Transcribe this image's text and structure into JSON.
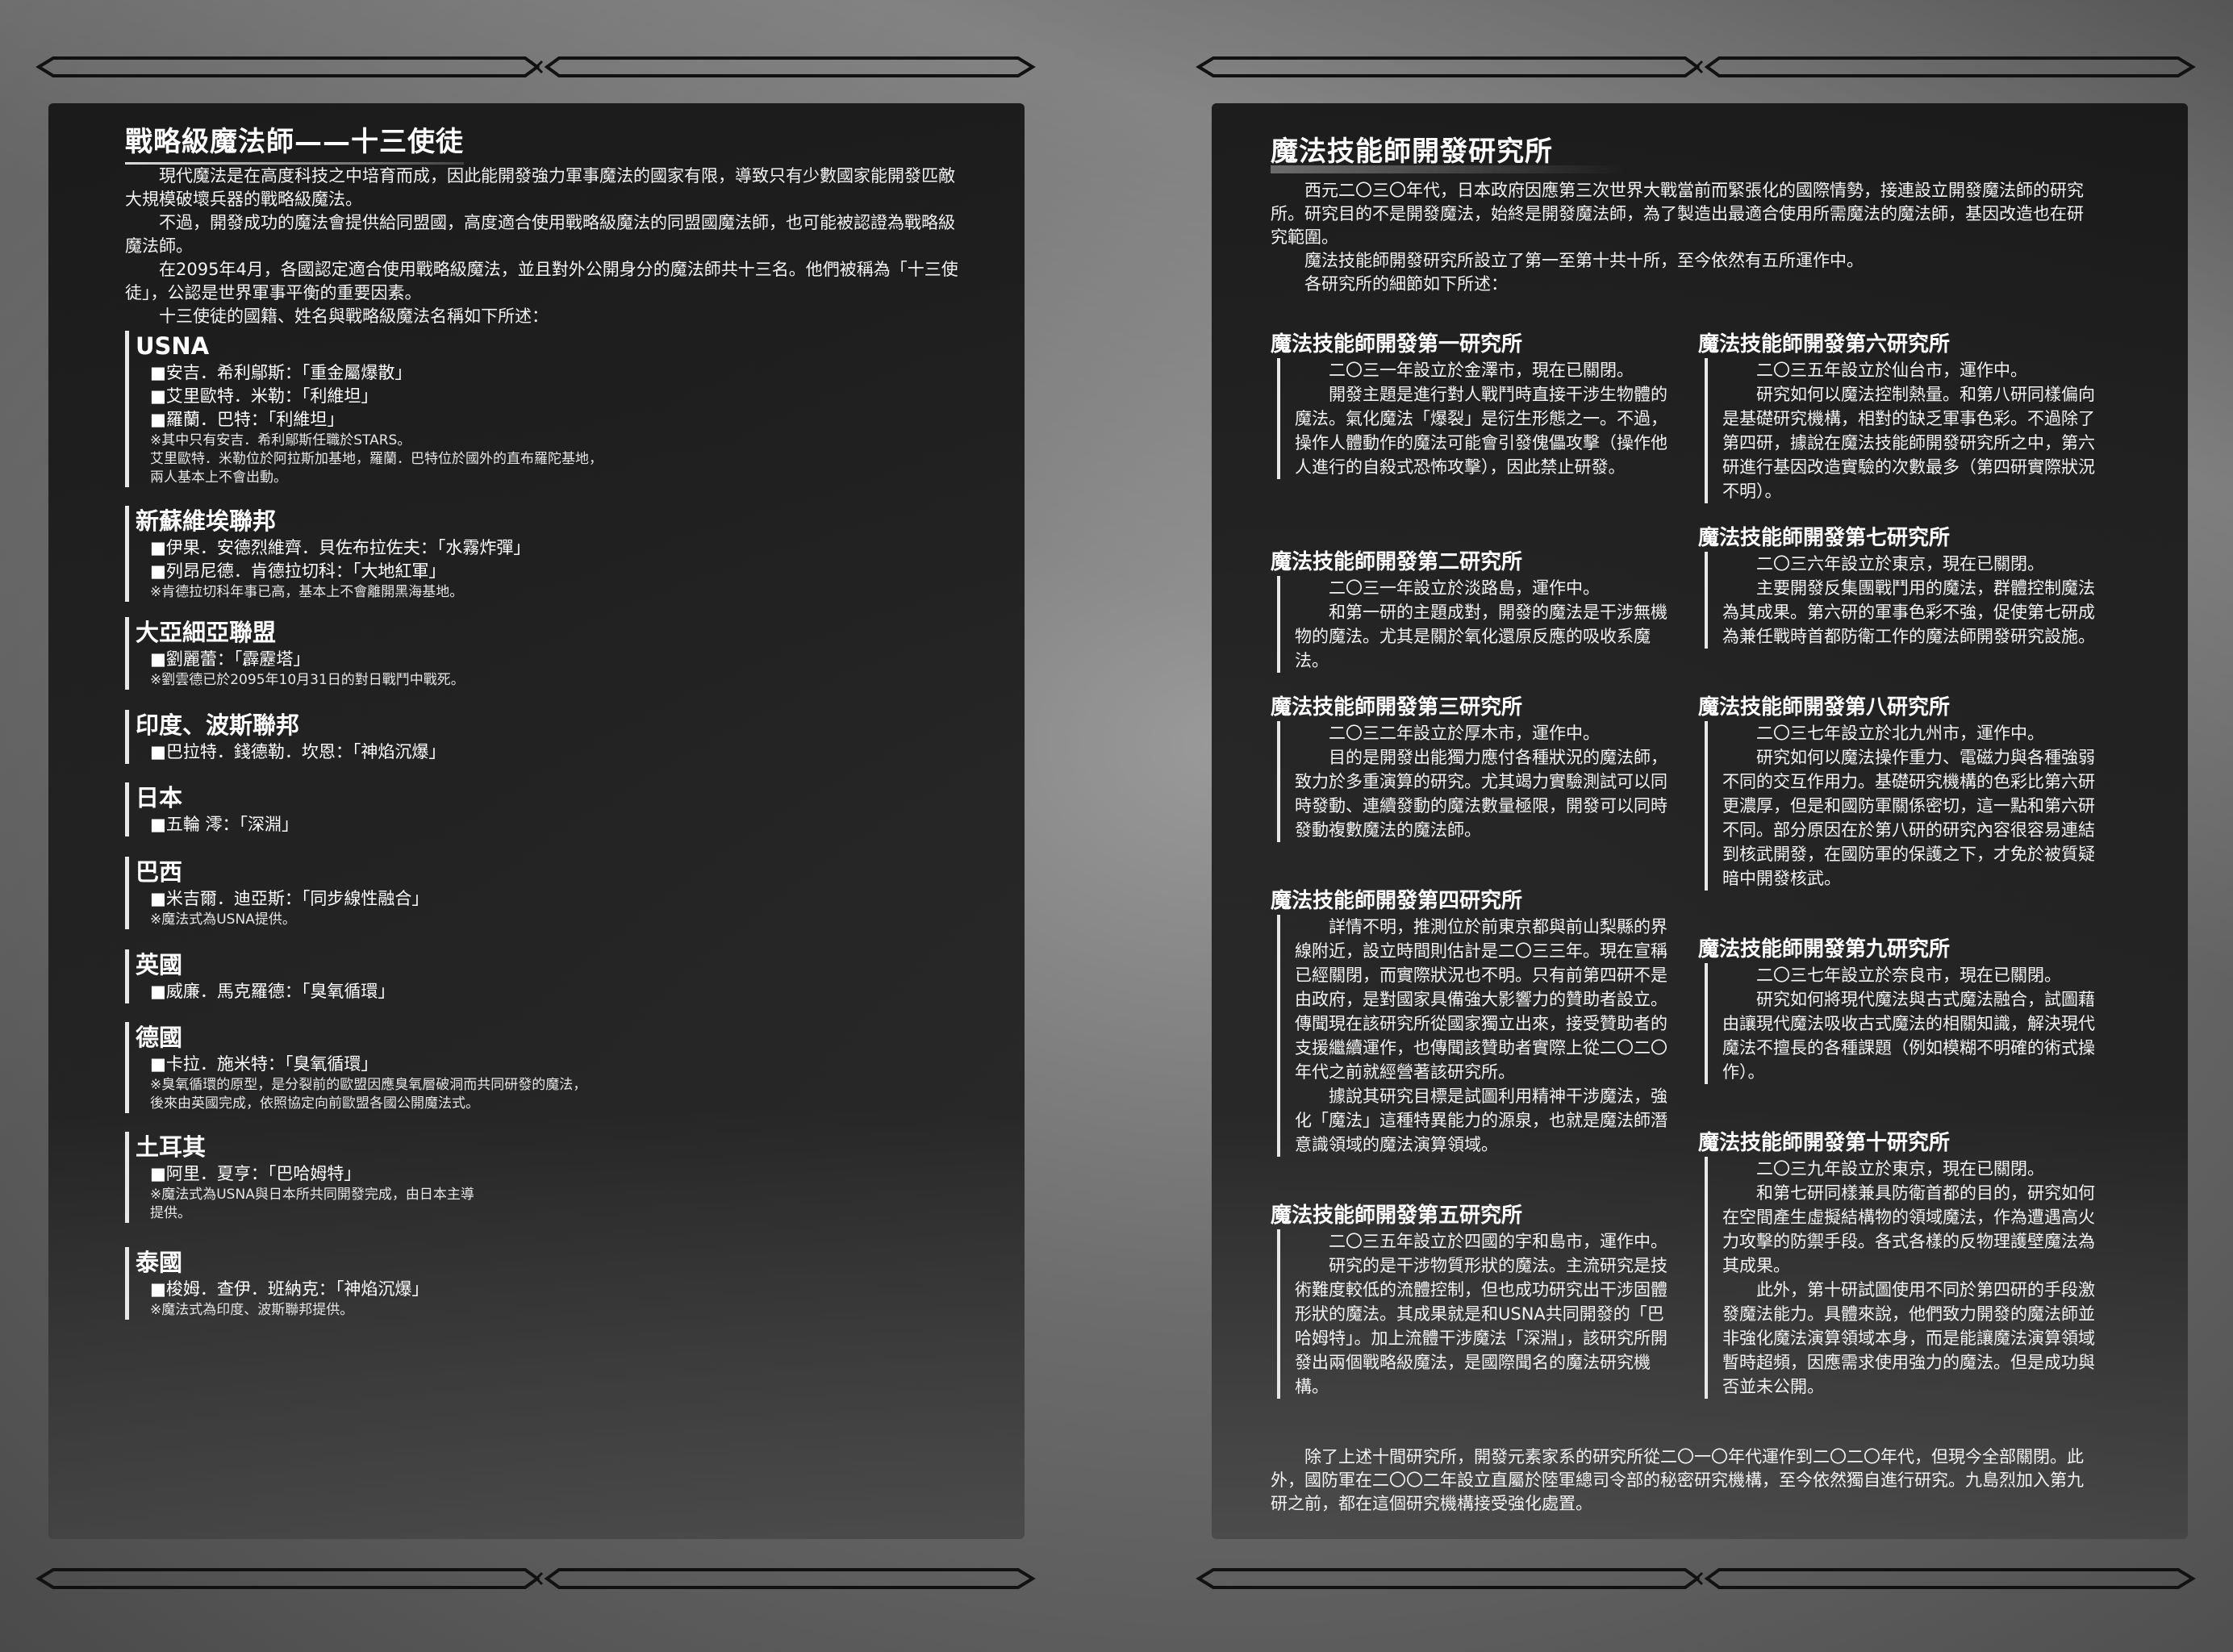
{
  "left_page": {
    "title": "戰略級魔法師——十三使徒",
    "intro": [
      "現代魔法是在高度科技之中培育而成，因此能開發強力軍事魔法的國家有限，導致只有少數國家能開發匹敵大規模破壞兵器的戰略級魔法。",
      "不過，開發成功的魔法會提供給同盟國，高度適合使用戰略級魔法的同盟國魔法師，也可能被認證為戰略級魔法師。",
      "在2095年4月，各國認定適合使用戰略級魔法，並且對外公開身分的魔法師共十三名。他們被稱為「十三使徒」，公認是世界軍事平衡的重要因素。",
      "十三使徒的國籍、姓名與戰略級魔法名稱如下所述："
    ],
    "nations": [
      {
        "name": "USNA",
        "members": [
          "■安吉．希利鄔斯：「重金屬爆散」",
          "■艾里歐特．米勒：「利維坦」",
          "■羅蘭．巴特：「利維坦」"
        ],
        "notes": [
          "※其中只有安吉．希利鄔斯任職於STARS。",
          "艾里歐特．米勒位於阿拉斯加基地，羅蘭．巴特位於國外的直布羅陀基地，",
          "兩人基本上不會出動。"
        ]
      },
      {
        "name": "新蘇維埃聯邦",
        "members": [
          "■伊果．安德烈維齊．貝佐布拉佐夫：「水霧炸彈」",
          "■列昂尼德．肯德拉切科：「大地紅軍」"
        ],
        "notes": [
          "※肯德拉切科年事已高，基本上不會離開黑海基地。"
        ]
      },
      {
        "name": "大亞細亞聯盟",
        "members": [
          "■劉麗蕾：「霹靂塔」"
        ],
        "notes": [
          "※劉雲德已於2095年10月31日的對日戰鬥中戰死。"
        ]
      },
      {
        "name": "印度、波斯聯邦",
        "members": [
          "■巴拉特．錢德勒．坎恩：「神焰沉爆」"
        ],
        "notes": []
      },
      {
        "name": "日本",
        "members": [
          "■五輪 澪：「深淵」"
        ],
        "notes": []
      },
      {
        "name": "巴西",
        "members": [
          "■米吉爾．迪亞斯：「同步線性融合」"
        ],
        "notes": [
          "※魔法式為USNA提供。"
        ]
      },
      {
        "name": "英國",
        "members": [
          "■威廉．馬克羅德：「臭氧循環」"
        ],
        "notes": []
      },
      {
        "name": "德國",
        "members": [
          "■卡拉．施米特：「臭氧循環」"
        ],
        "notes": [
          "※臭氧循環的原型，是分裂前的歐盟因應臭氧層破洞而共同研發的魔法，",
          "後來由英國完成，依照協定向前歐盟各國公開魔法式。"
        ]
      },
      {
        "name": "土耳其",
        "members": [
          "■阿里．夏亨：「巴哈姆特」"
        ],
        "notes": [
          "※魔法式為USNA與日本所共同開發完成，由日本主導",
          "提供。"
        ]
      },
      {
        "name": "泰國",
        "members": [
          "■梭姆．查伊．班納克：「神焰沉爆」"
        ],
        "notes": [
          "※魔法式為印度、波斯聯邦提供。"
        ]
      }
    ]
  },
  "right_page": {
    "title": "魔法技能師開發研究所",
    "intro": [
      "西元二〇三〇年代，日本政府因應第三次世界大戰當前而緊張化的國際情勢，接連設立開發魔法師的研究所。研究目的不是開發魔法，始終是開發魔法師，為了製造出最適合使用所需魔法的魔法師，基因改造也在研究範圍。",
      "魔法技能師開發研究所設立了第一至第十共十所，至今依然有五所運作中。",
      "各研究所的細節如下所述："
    ],
    "institutes": [
      {
        "heading": "魔法技能師開發第一研究所",
        "paragraphs": [
          "二〇三一年設立於金澤市，現在已關閉。",
          "開發主題是進行對人戰鬥時直接干涉生物體的魔法。氣化魔法「爆裂」是衍生形態之一。不過，操作人體動作的魔法可能會引發傀儡攻擊（操作他人進行的自殺式恐怖攻擊），因此禁止研發。"
        ]
      },
      {
        "heading": "魔法技能師開發第二研究所",
        "paragraphs": [
          "二〇三一年設立於淡路島，運作中。",
          "和第一研的主題成對，開發的魔法是干涉無機物的魔法。尤其是關於氧化還原反應的吸收系魔法。"
        ]
      },
      {
        "heading": "魔法技能師開發第三研究所",
        "paragraphs": [
          "二〇三二年設立於厚木市，運作中。",
          "目的是開發出能獨力應付各種狀況的魔法師，致力於多重演算的研究。尤其竭力實驗測試可以同時發動、連續發動的魔法數量極限，開發可以同時發動複數魔法的魔法師。"
        ]
      },
      {
        "heading": "魔法技能師開發第四研究所",
        "paragraphs": [
          "詳情不明，推測位於前東京都與前山梨縣的界線附近，設立時間則估計是二〇三三年。現在宣稱已經關閉，而實際狀況也不明。只有前第四研不是由政府，是對國家具備強大影響力的贊助者設立。傳聞現在該研究所從國家獨立出來，接受贊助者的支援繼續運作，也傳聞該贊助者實際上從二〇二〇年代之前就經營著該研究所。",
          "據說其研究目標是試圖利用精神干涉魔法，強化「魔法」這種特異能力的源泉，也就是魔法師潛意識領域的魔法演算領域。"
        ]
      },
      {
        "heading": "魔法技能師開發第五研究所",
        "paragraphs": [
          "二〇三五年設立於四國的宇和島市，運作中。",
          "研究的是干涉物質形狀的魔法。主流研究是技術難度較低的流體控制，但也成功研究出干涉固體形狀的魔法。其成果就是和USNA共同開發的「巴哈姆特」。加上流體干涉魔法「深淵」，該研究所開發出兩個戰略級魔法，是國際聞名的魔法研究機構。"
        ]
      },
      {
        "heading": "魔法技能師開發第六研究所",
        "paragraphs": [
          "二〇三五年設立於仙台市，運作中。",
          "研究如何以魔法控制熱量。和第八研同樣偏向是基礎研究機構，相對的缺乏軍事色彩。不過除了第四研，據說在魔法技能師開發研究所之中，第六研進行基因改造實驗的次數最多（第四研實際狀況不明）。"
        ]
      },
      {
        "heading": "魔法技能師開發第七研究所",
        "paragraphs": [
          "二〇三六年設立於東京，現在已關閉。",
          "主要開發反集團戰鬥用的魔法，群體控制魔法為其成果。第六研的軍事色彩不強，促使第七研成為兼任戰時首都防衛工作的魔法師開發研究設施。"
        ]
      },
      {
        "heading": "魔法技能師開發第八研究所",
        "paragraphs": [
          "二〇三七年設立於北九州市，運作中。",
          "研究如何以魔法操作重力、電磁力與各種強弱不同的交互作用力。基礎研究機構的色彩比第六研更濃厚，但是和國防軍關係密切，這一點和第六研不同。部分原因在於第八研的研究內容很容易連結到核武開發，在國防軍的保護之下，才免於被質疑暗中開發核武。"
        ]
      },
      {
        "heading": "魔法技能師開發第九研究所",
        "paragraphs": [
          "二〇三七年設立於奈良市，現在已關閉。",
          "研究如何將現代魔法與古式魔法融合，試圖藉由讓現代魔法吸收古式魔法的相關知識，解決現代魔法不擅長的各種課題（例如模糊不明確的術式操作）。"
        ]
      },
      {
        "heading": "魔法技能師開發第十研究所",
        "paragraphs": [
          "二〇三九年設立於東京，現在已關閉。",
          "和第七研同樣兼具防衛首都的目的，研究如何在空間產生虛擬結構物的領域魔法，作為遭遇高火力攻擊的防禦手段。各式各樣的反物理護壁魔法為其成果。",
          "此外，第十研試圖使用不同於第四研的手段激發魔法能力。具體來說，他們致力開發的魔法師並非強化魔法演算領域本身，而是能讓魔法演算領域暫時超頻，因應需求使用強力的魔法。但是成功與否並未公開。"
        ]
      }
    ],
    "closing": "除了上述十間研究所，開發元素家系的研究所從二〇一〇年代運作到二〇二〇年代，但現今全部關閉。此外，國防軍在二〇〇二年設立直屬於陸軍總司令部的秘密研究機構，至今依然獨自進行研究。九島烈加入第九研之前，都在這個研究機構接受強化處置。"
  }
}
